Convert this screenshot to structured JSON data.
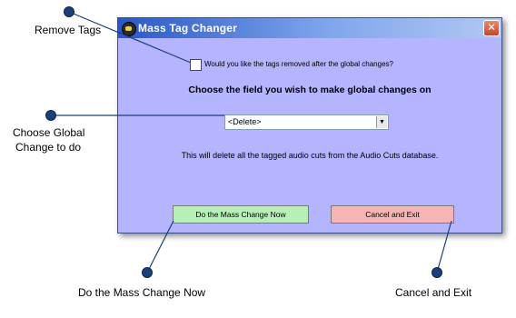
{
  "window": {
    "title": "Mass Tag Changer",
    "close_glyph": "✕"
  },
  "checkbox": {
    "label": "Would you like the tags removed after the global changes?",
    "checked": false
  },
  "heading": "Choose the field you wish to make global changes on",
  "select": {
    "value": "<Delete>",
    "arrow": "▼"
  },
  "description": "This will delete all the tagged audio cuts from the Audio Cuts database.",
  "buttons": {
    "mass_change": "Do the Mass Change Now",
    "cancel": "Cancel and Exit"
  },
  "callouts": {
    "remove_tags": "Remove Tags",
    "choose_global_line1": "Choose Global",
    "choose_global_line2": "Change to do",
    "mass_change": "Do the Mass Change Now",
    "cancel": "Cancel and Exit"
  },
  "colors": {
    "window_bg": "#b4b4ff",
    "callout_dot": "#1a3f7a",
    "go_button": "#b7f0b7",
    "cancel_button": "#f7b4b4"
  }
}
